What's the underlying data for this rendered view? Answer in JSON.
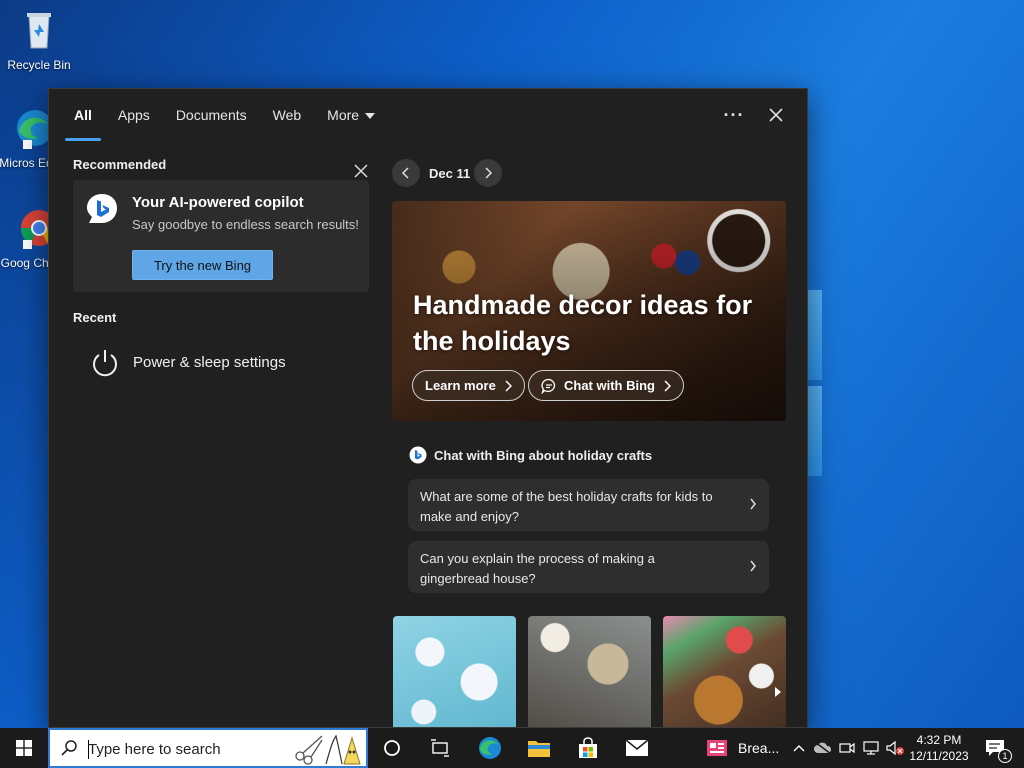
{
  "desktop": {
    "icons": [
      {
        "label": "Recycle Bin"
      },
      {
        "label": "Micros Edge"
      },
      {
        "label": "Goog Chron"
      }
    ]
  },
  "panel": {
    "tabs": [
      {
        "label": "All",
        "active": true
      },
      {
        "label": "Apps"
      },
      {
        "label": "Documents"
      },
      {
        "label": "Web"
      },
      {
        "label": "More"
      }
    ],
    "more_options_label": "···",
    "recommended": {
      "title": "Recommended",
      "card_title": "Your AI-powered copilot",
      "card_subtitle": "Say goodbye to endless search results!",
      "button_label": "Try the new Bing"
    },
    "recent": {
      "title": "Recent",
      "items": [
        {
          "label": "Power & sleep settings",
          "icon": "power-icon"
        }
      ]
    },
    "news": {
      "date": "Dec 11",
      "hero_title": "Handmade decor ideas for the holidays",
      "learn_more_label": "Learn more",
      "chat_with_bing_label": "Chat with Bing",
      "chat_heading": "Chat with Bing about holiday crafts",
      "questions": [
        {
          "text": "What are some of the best holiday crafts for kids to make and enjoy?"
        },
        {
          "text": "Can you explain the process of making a gingerbread house?"
        }
      ]
    }
  },
  "taskbar": {
    "search_placeholder": "Type here to search",
    "running_app_label": "Brea...",
    "clock_time": "4:32 PM",
    "clock_date": "12/11/2023",
    "notification_count": "1"
  },
  "colors": {
    "accent": "#4aa0f0",
    "panel_bg": "#202020",
    "card_bg": "#2c2c2c",
    "bing_button": "#5fa6e6",
    "taskbar_bg": "#1b1b1b"
  }
}
